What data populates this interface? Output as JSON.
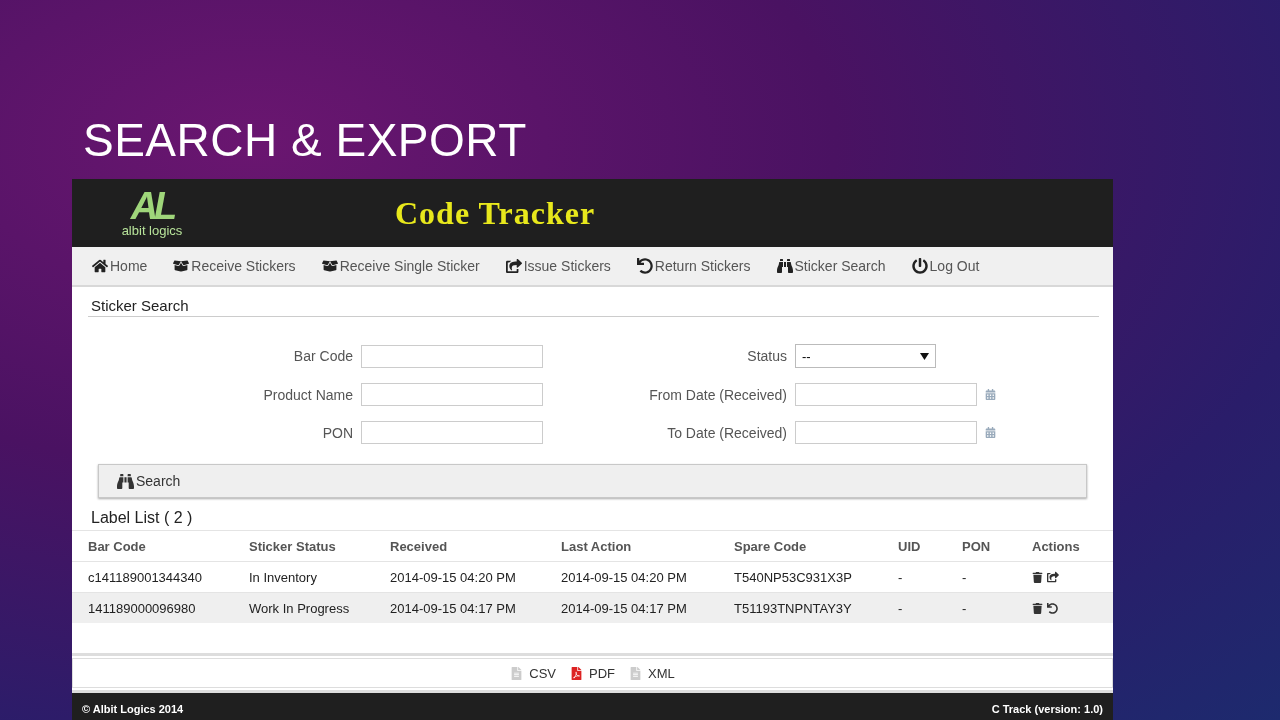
{
  "slide_title": "SEARCH & EXPORT",
  "app": {
    "logo": {
      "mark": "AL",
      "text": "albit logics"
    },
    "title": "Code Tracker",
    "nav": [
      {
        "label": "Home",
        "kind": "home"
      },
      {
        "label": "Receive Stickers",
        "kind": "receive"
      },
      {
        "label": "Receive Single Sticker",
        "kind": "receive"
      },
      {
        "label": "Issue Stickers",
        "kind": "issue"
      },
      {
        "label": "Return Stickers",
        "kind": "return"
      },
      {
        "label": "Sticker Search",
        "kind": "search"
      },
      {
        "label": "Log Out",
        "kind": "logout"
      }
    ],
    "section_title": "Sticker Search",
    "form": [
      {
        "label": "Bar Code",
        "kind": "text"
      },
      {
        "label": "Status",
        "kind": "select",
        "value": "--"
      },
      {
        "label": "Product Name",
        "kind": "text"
      },
      {
        "label": "From Date (Received)",
        "kind": "date"
      },
      {
        "label": "PON",
        "kind": "text"
      },
      {
        "label": "To Date (Received)",
        "kind": "date"
      }
    ],
    "search_button": "Search",
    "list_title": "Label List ( 2 )",
    "table": {
      "columns": [
        "Bar Code",
        "Sticker Status",
        "Received",
        "Last Action",
        "Spare Code",
        "UID",
        "PON",
        "Actions"
      ],
      "rows": [
        {
          "cells": [
            "c141189001344340",
            "In Inventory",
            "2014-09-15 04:20 PM",
            "2014-09-15 04:20 PM",
            "T540NP53C931X3P",
            "-",
            "-"
          ],
          "actions": [
            {
              "kind": "delete"
            },
            {
              "kind": "issue"
            }
          ]
        },
        {
          "cells": [
            "141189000096980",
            "Work In Progress",
            "2014-09-15 04:17 PM",
            "2014-09-15 04:17 PM",
            "T51193TNPNTAY3Y",
            "-",
            "-"
          ],
          "actions": [
            {
              "kind": "delete"
            },
            {
              "kind": "return"
            }
          ]
        }
      ]
    },
    "export": [
      {
        "label": "CSV",
        "kind": "file"
      },
      {
        "label": "PDF",
        "kind": "pdf"
      },
      {
        "label": "XML",
        "kind": "file"
      }
    ],
    "footer": {
      "left": "© Albit Logics 2014",
      "right": "C Track (version: 1.0)"
    }
  }
}
